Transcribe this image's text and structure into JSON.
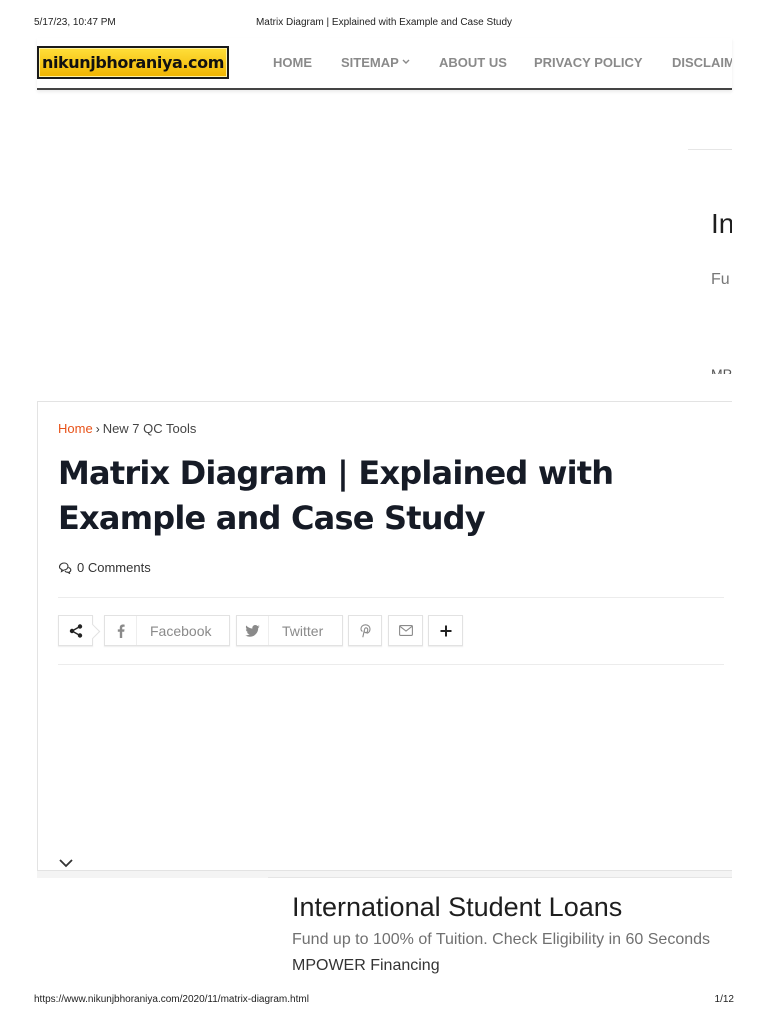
{
  "print_header": {
    "datetime": "5/17/23, 10:47 PM",
    "doc_title": "Matrix Diagram | Explained with Example and Case Study"
  },
  "print_footer": {
    "url": "https://www.nikunjbhoraniya.com/2020/11/matrix-diagram.html",
    "page": "1/12"
  },
  "site": {
    "logo_text": "nikunjbhoraniya.com",
    "logo_colors": [
      "#ffdf3a",
      "#f0b400"
    ]
  },
  "nav": {
    "home": "HOME",
    "sitemap": "SITEMAP",
    "about": "ABOUT US",
    "privacy": "PRIVACY POLICY",
    "disclaimer": "DISCLAIM"
  },
  "side_ad": {
    "title": "In",
    "desc": "Fu",
    "advertiser": "MP"
  },
  "breadcrumb": {
    "home": "Home",
    "separator": "›",
    "category": "New 7 QC Tools"
  },
  "post": {
    "title": "Matrix Diagram | Explained with Example and Case Study",
    "comments": "0 Comments"
  },
  "share": {
    "facebook": "Facebook",
    "twitter": "Twitter",
    "icons": [
      "share-icon",
      "facebook-icon",
      "twitter-icon",
      "pinterest-icon",
      "email-icon",
      "plus-icon"
    ]
  },
  "bottom_ad": {
    "title": "International Student Loans",
    "desc": "Fund up to 100% of Tuition. Check Eligibility in 60 Seconds",
    "advertiser": "MPOWER Financing"
  },
  "colors": {
    "accent": "#e8531a",
    "title": "#161b26",
    "nav_text": "#8a8a8a"
  }
}
